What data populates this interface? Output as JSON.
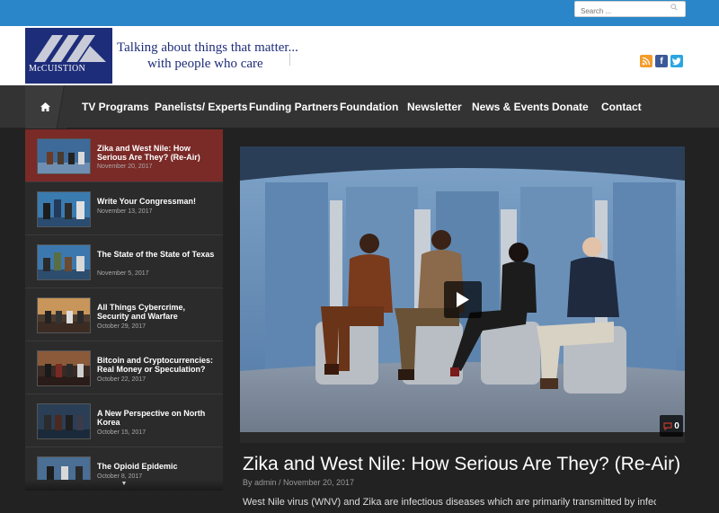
{
  "search": {
    "placeholder": "Search ..."
  },
  "header": {
    "logo_text": "McCUISTION",
    "tagline_line1": "Talking about things that matter...",
    "tagline_line2": "with people who care",
    "social": [
      "rss-icon",
      "facebook-icon",
      "twitter-icon"
    ]
  },
  "nav": {
    "home_icon": "home-icon",
    "items": [
      {
        "label": "TV Programs"
      },
      {
        "label": "Panelists/ Experts"
      },
      {
        "label": "Funding Partners"
      },
      {
        "label": "Foundation"
      },
      {
        "label": "Newsletter"
      },
      {
        "label": "News & Events"
      },
      {
        "label": "Donate"
      },
      {
        "label": "Contact"
      }
    ]
  },
  "playlist": {
    "items": [
      {
        "title": "Zika and West Nile: How Serious Are They? (Re-Air)",
        "date": "November 20, 2017",
        "active": true
      },
      {
        "title": "Write Your Congressman!",
        "date": "November 13, 2017",
        "active": false
      },
      {
        "title": "The State of the State of Texas",
        "date": "November 5, 2017",
        "active": false
      },
      {
        "title": "All Things Cybercrime, Security and Warfare",
        "date": "October 29, 2017",
        "active": false
      },
      {
        "title": "Bitcoin and Cryptocurrencies: Real Money or Speculation?",
        "date": "October 22, 2017",
        "active": false
      },
      {
        "title": "A New Perspective on North Korea",
        "date": "October 15, 2017",
        "active": false
      },
      {
        "title": "The Opioid Epidemic",
        "date": "October 8, 2017",
        "active": false
      }
    ],
    "scroll_glyph": "▼"
  },
  "video": {
    "comment_count": "0"
  },
  "post": {
    "title": "Zika and West Nile: How Serious Are They? (Re-Air)",
    "meta": "By admin / November 20, 2017",
    "excerpt": "West Nile virus (WNV) and Zika are infectious diseases which are primarily transmitted by infected"
  },
  "colors": {
    "topbar": "#2a86c8",
    "logo_bg": "#1e2d7a",
    "nav_bg": "#333333",
    "active_item": "#7a2a27"
  }
}
